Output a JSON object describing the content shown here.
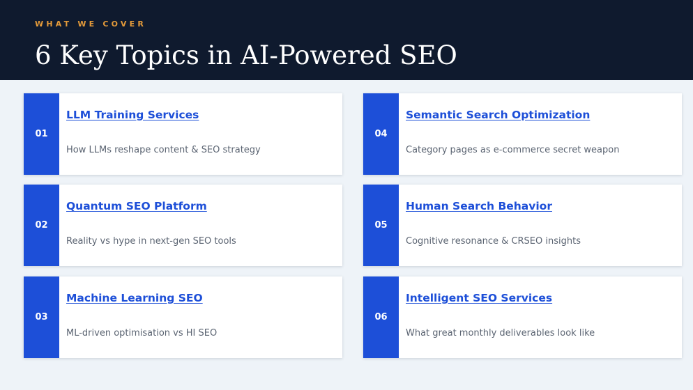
{
  "header": {
    "eyebrow": "WHAT WE COVER",
    "title": "6 Key Topics in AI-Powered SEO"
  },
  "topics": [
    {
      "num": "01",
      "title": "LLM Training Services",
      "desc": "How LLMs reshape content & SEO strategy"
    },
    {
      "num": "02",
      "title": "Quantum SEO Platform",
      "desc": "Reality vs hype in next-gen SEO tools"
    },
    {
      "num": "03",
      "title": "Machine Learning SEO",
      "desc": "ML-driven optimisation vs HI SEO"
    },
    {
      "num": "04",
      "title": "Semantic Search Optimization",
      "desc": "Category pages as e-commerce secret weapon"
    },
    {
      "num": "05",
      "title": "Human Search Behavior",
      "desc": "Cognitive resonance & CRSEO insights"
    },
    {
      "num": "06",
      "title": "Intelligent SEO Services",
      "desc": "What great monthly deliverables look like"
    }
  ],
  "colors": {
    "header_bg": "#0f1a2e",
    "accent": "#1d4fd8",
    "eyebrow": "#e39a3a"
  }
}
